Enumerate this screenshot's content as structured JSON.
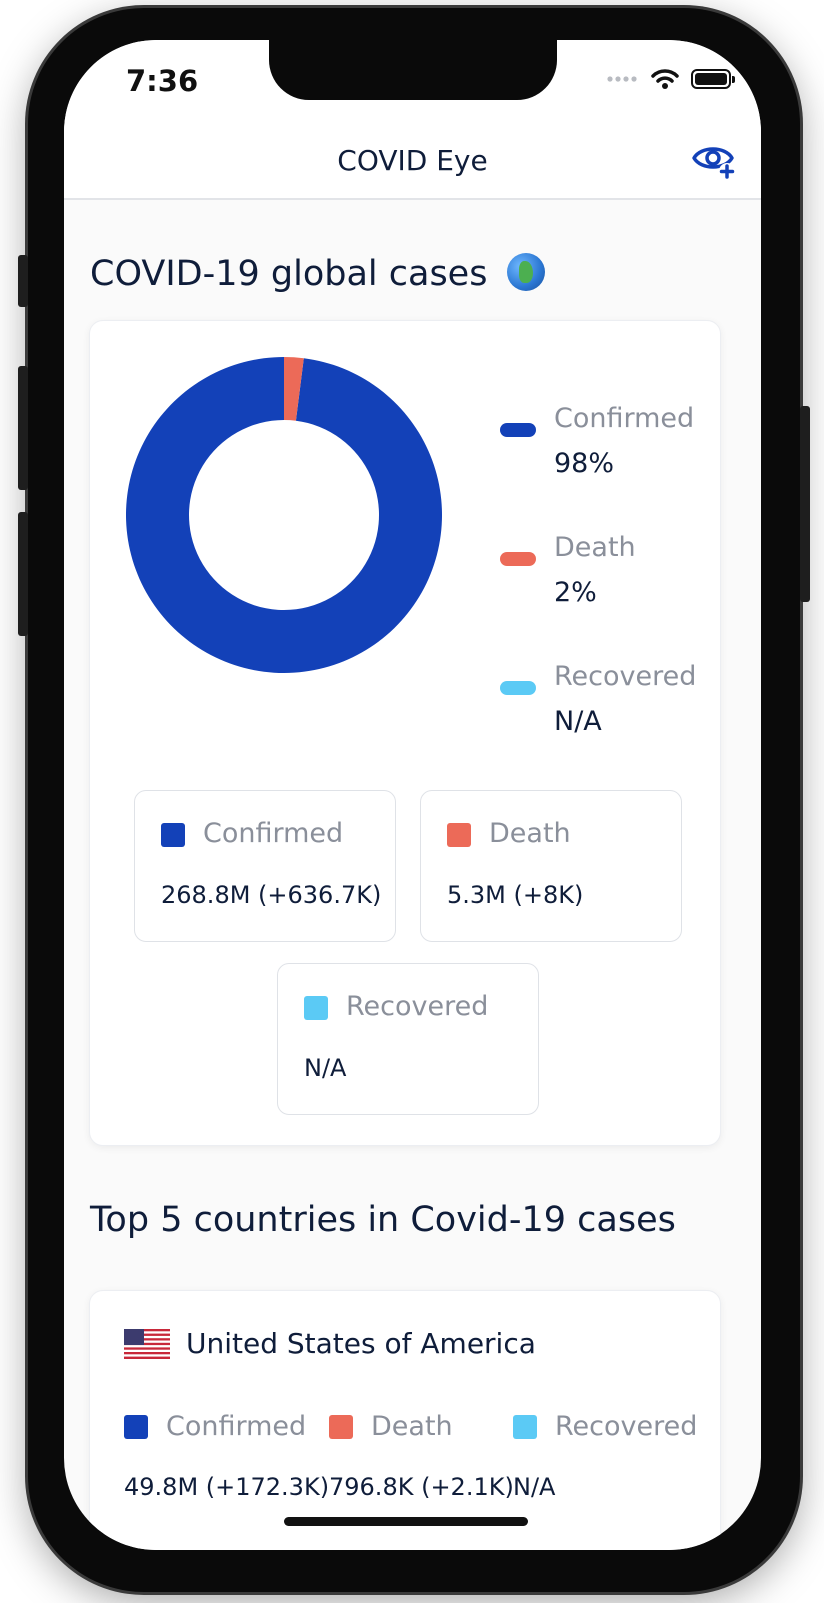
{
  "status_bar": {
    "time": "7:36"
  },
  "nav": {
    "title": "COVID Eye",
    "action_icon": "eye-plus-icon"
  },
  "colors": {
    "confirmed": "#1341b8",
    "death": "#ec6a58",
    "recovered": "#5bcaf5",
    "text_dark": "#0f1d3a",
    "text_muted": "#8a8f9a"
  },
  "global": {
    "title": "COVID-19 global cases",
    "title_icon": "globe-icon",
    "chart_data": {
      "type": "pie",
      "donut": true,
      "categories": [
        "Confirmed",
        "Death",
        "Recovered"
      ],
      "values": [
        98,
        2,
        0
      ],
      "legend_position": "right"
    },
    "legend": [
      {
        "label": "Confirmed",
        "value": "98%"
      },
      {
        "label": "Death",
        "value": "2%"
      },
      {
        "label": "Recovered",
        "value": "N/A"
      }
    ],
    "stats": {
      "confirmed": {
        "label": "Confirmed",
        "value": "268.8M (+636.7K)"
      },
      "death": {
        "label": "Death",
        "value": "5.3M (+8K)"
      },
      "recovered": {
        "label": "Recovered",
        "value": "N/A"
      }
    }
  },
  "top": {
    "title": "Top 5 countries in Covid-19 cases",
    "countries": [
      {
        "name": "United States of America",
        "flag_icon": "us-flag-icon",
        "confirmed": {
          "label": "Confirmed",
          "value": "49.8M (+172.3K)"
        },
        "death": {
          "label": "Death",
          "value": "796.8K (+2.1K)"
        },
        "recovered": {
          "label": "Recovered",
          "value": "N/A"
        }
      }
    ]
  }
}
